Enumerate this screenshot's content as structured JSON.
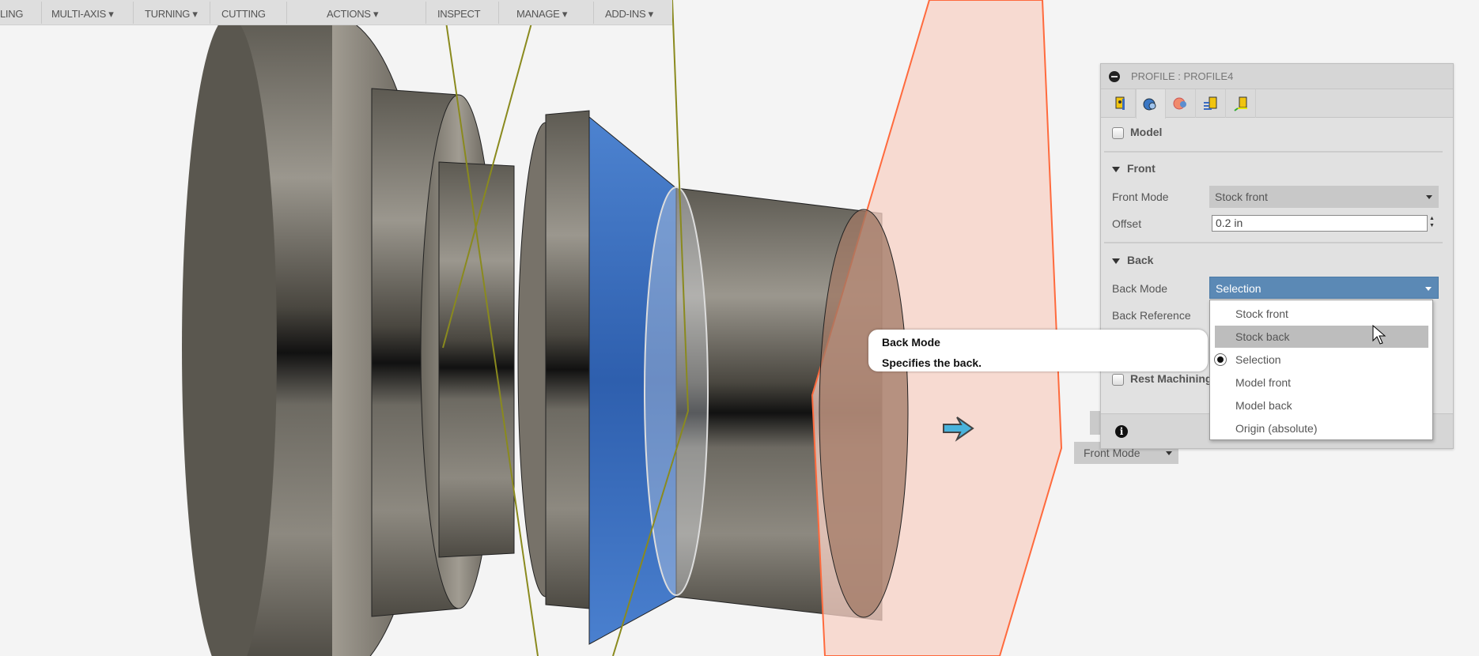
{
  "toolbar": {
    "items": [
      "LING",
      "MULTI-AXIS ▾",
      "TURNING ▾",
      "CUTTING",
      "ACTIONS ▾",
      "INSPECT",
      "MANAGE ▾",
      "ADD-INS ▾"
    ]
  },
  "panel": {
    "title": "PROFILE : PROFILE4",
    "tabs": [
      "tool-icon",
      "geometry-icon",
      "heights-icon",
      "passes-icon",
      "linking-icon"
    ],
    "model_label": "Model",
    "front": {
      "heading": "Front",
      "mode_label": "Front Mode",
      "mode_value": "Stock front",
      "offset_label": "Offset",
      "offset_value": "0.2 in"
    },
    "back": {
      "heading": "Back",
      "mode_label": "Back Mode",
      "mode_value": "Selection",
      "reference_label": "Back Reference"
    },
    "rest_machining_label": "Rest Machining"
  },
  "dropdown": {
    "options": [
      "Stock front",
      "Stock back",
      "Selection",
      "Model front",
      "Model back",
      "Origin (absolute)"
    ],
    "selected": "Selection",
    "hovered": "Stock back"
  },
  "tooltip": {
    "title": "Back Mode",
    "description": "Specifies the back."
  },
  "background_dropdown": {
    "value": "Front Mode"
  },
  "colors": {
    "accent": "#5b89b5",
    "selected_face": "#3a72c4",
    "plane": "#f8d6cc",
    "plane_edge": "#ff6a3d"
  }
}
